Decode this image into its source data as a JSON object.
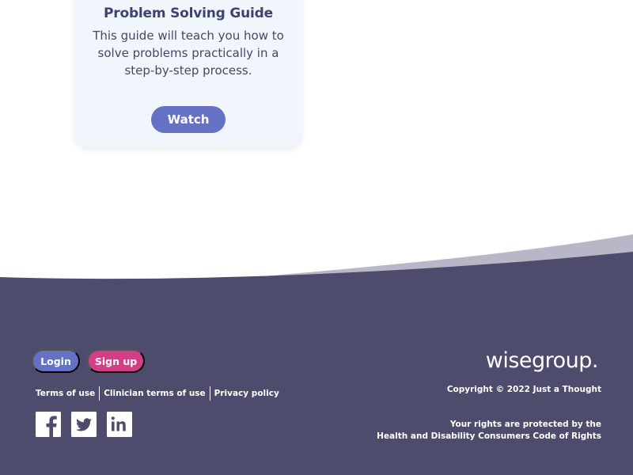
{
  "card": {
    "title": "Problem Solving Guide",
    "description": "This guide will teach you how to solve problems practically in a step-by-step process.",
    "watch_label": "Watch"
  },
  "footer": {
    "login_label": "Login",
    "signup_label": "Sign up",
    "links": [
      "Terms of use",
      "Clinician terms of use",
      "Privacy policy"
    ],
    "social_icons": [
      "facebook-icon",
      "twitter-icon",
      "linkedin-icon"
    ],
    "brand": "wisegroup.",
    "copyright": "Copyright © 2022 Just a Thought",
    "rights_line1": "Your rights are protected by the",
    "rights_line2": "Health and Disability Consumers Code of Rights"
  },
  "colors": {
    "footer_bg": "#4e4c6c",
    "wave_accent": "#b9b6c8",
    "primary": "#6471c4",
    "signup": "#d23f86",
    "card_bg": "#f1f6fd",
    "card_title": "#3f4270"
  }
}
